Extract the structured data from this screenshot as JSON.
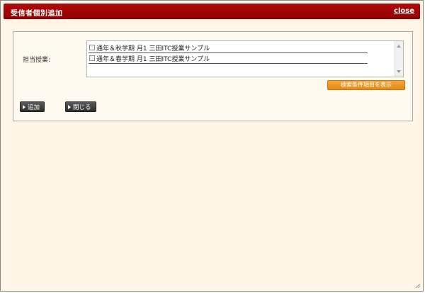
{
  "dialog": {
    "title": "受信者個別追加",
    "close_label": "close"
  },
  "form": {
    "field_label": "担当授業:",
    "courses": [
      {
        "label": "通年＆秋学期 月1 三田ITC授業サンプル",
        "checked": false
      },
      {
        "label": "通年＆春学期 月1 三田ITC授業サンプル",
        "checked": false
      }
    ],
    "search_conditions_button": "検索条件項目を表示"
  },
  "actions": {
    "add_label": "追加",
    "close_label": "閉じる"
  },
  "colors": {
    "titlebar": "#9a0000",
    "background": "#fff5e6",
    "accent_orange": "#ec9428",
    "button_dark": "#3a3a3a"
  }
}
